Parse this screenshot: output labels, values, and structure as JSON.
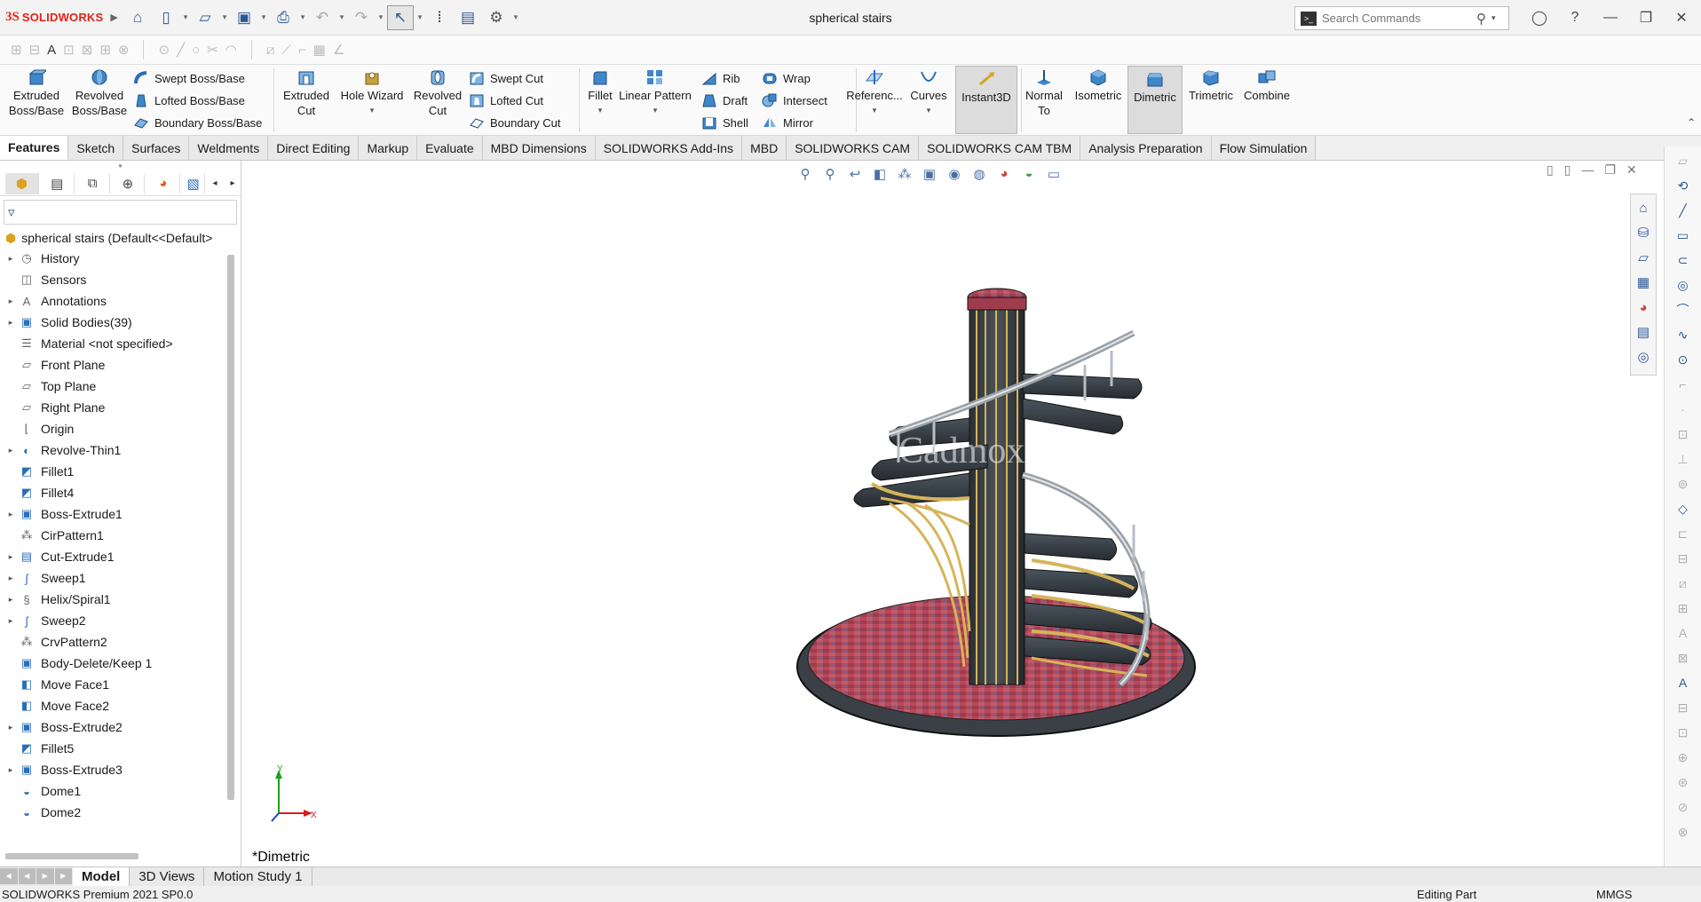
{
  "app": {
    "brand": "SOLIDWORKS",
    "document_title": "spherical stairs"
  },
  "search": {
    "placeholder": "Search Commands"
  },
  "ribbon": {
    "extruded_boss": "Extruded Boss/Base",
    "revolved_boss": "Revolved Boss/Base",
    "swept_boss": "Swept Boss/Base",
    "lofted_boss": "Lofted Boss/Base",
    "boundary_boss": "Boundary Boss/Base",
    "extruded_cut": "Extruded Cut",
    "hole_wizard": "Hole Wizard",
    "revolved_cut": "Revolved Cut",
    "swept_cut": "Swept Cut",
    "lofted_cut": "Lofted Cut",
    "boundary_cut": "Boundary Cut",
    "fillet": "Fillet",
    "linear_pattern": "Linear Pattern",
    "rib": "Rib",
    "draft": "Draft",
    "shell": "Shell",
    "wrap": "Wrap",
    "intersect": "Intersect",
    "mirror": "Mirror",
    "reference": "Referenc...",
    "curves": "Curves",
    "instant3d": "Instant3D",
    "normal_to": "Normal To",
    "isometric": "Isometric",
    "dimetric": "Dimetric",
    "trimetric": "Trimetric",
    "combine": "Combine"
  },
  "tabs": [
    "Features",
    "Sketch",
    "Surfaces",
    "Weldments",
    "Direct Editing",
    "Markup",
    "Evaluate",
    "MBD Dimensions",
    "SOLIDWORKS Add-Ins",
    "MBD",
    "SOLIDWORKS CAM",
    "SOLIDWORKS CAM TBM",
    "Analysis Preparation",
    "Flow Simulation"
  ],
  "tree": {
    "root": "spherical stairs  (Default<<Default>",
    "items": [
      {
        "label": "History",
        "icon": "history-icon"
      },
      {
        "label": "Sensors",
        "icon": "sensor-icon"
      },
      {
        "label": "Annotations",
        "icon": "annotation-icon"
      },
      {
        "label": "Solid Bodies(39)",
        "icon": "solid-bodies-icon"
      },
      {
        "label": "Material <not specified>",
        "icon": "material-icon"
      },
      {
        "label": "Front Plane",
        "icon": "plane-icon"
      },
      {
        "label": "Top Plane",
        "icon": "plane-icon"
      },
      {
        "label": "Right Plane",
        "icon": "plane-icon"
      },
      {
        "label": "Origin",
        "icon": "origin-icon"
      },
      {
        "label": "Revolve-Thin1",
        "icon": "revolve-icon"
      },
      {
        "label": "Fillet1",
        "icon": "fillet-icon"
      },
      {
        "label": "Fillet4",
        "icon": "fillet-icon"
      },
      {
        "label": "Boss-Extrude1",
        "icon": "extrude-icon"
      },
      {
        "label": "CirPattern1",
        "icon": "pattern-icon"
      },
      {
        "label": "Cut-Extrude1",
        "icon": "cut-icon"
      },
      {
        "label": "Sweep1",
        "icon": "sweep-icon"
      },
      {
        "label": "Helix/Spiral1",
        "icon": "helix-icon"
      },
      {
        "label": "Sweep2",
        "icon": "sweep-icon"
      },
      {
        "label": "CrvPattern2",
        "icon": "pattern-icon"
      },
      {
        "label": "Body-Delete/Keep 1",
        "icon": "body-delete-icon"
      },
      {
        "label": "Move Face1",
        "icon": "move-face-icon"
      },
      {
        "label": "Move Face2",
        "icon": "move-face-icon"
      },
      {
        "label": "Boss-Extrude2",
        "icon": "extrude-icon"
      },
      {
        "label": "Fillet5",
        "icon": "fillet-icon"
      },
      {
        "label": "Boss-Extrude3",
        "icon": "extrude-icon"
      },
      {
        "label": "Dome1",
        "icon": "dome-icon"
      },
      {
        "label": "Dome2",
        "icon": "dome-icon"
      }
    ]
  },
  "viewport": {
    "view_name": "*Dimetric",
    "watermark": "Cadmox"
  },
  "bottom_tabs": [
    "Model",
    "3D Views",
    "Motion Study 1"
  ],
  "status": {
    "version": "SOLIDWORKS Premium 2021 SP0.0",
    "mode": "Editing Part",
    "units": "MMGS"
  },
  "colors": {
    "brand": "#e2231a",
    "accent": "#2b5797"
  }
}
